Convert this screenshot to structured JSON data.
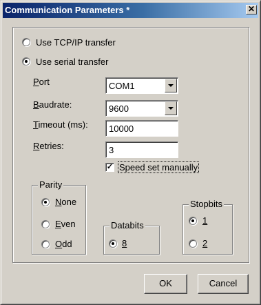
{
  "window": {
    "title": "Communication Parameters *",
    "close_glyph": "✕"
  },
  "transfer": {
    "tcpip_label": "Use TCP/IP transfer",
    "serial_label": "Use serial transfer",
    "selected": "serial"
  },
  "port": {
    "label_accel": "P",
    "label_rest": "ort",
    "value": "COM1"
  },
  "baudrate": {
    "label_accel": "B",
    "label_rest": "audrate:",
    "value": "9600"
  },
  "timeout": {
    "label_accel": "T",
    "label_rest": "imeout (ms):",
    "value": "10000"
  },
  "retries": {
    "label_accel": "R",
    "label_rest": "etries:",
    "value": "3"
  },
  "speed_manual": {
    "label": "Speed set manually",
    "checked": true,
    "check_glyph": "✓"
  },
  "parity": {
    "title": "Parity",
    "options": [
      {
        "accel": "N",
        "rest": "one",
        "selected": true
      },
      {
        "accel": "E",
        "rest": "ven",
        "selected": false
      },
      {
        "accel": "O",
        "rest": "dd",
        "selected": false
      }
    ]
  },
  "databits": {
    "title": "Databits",
    "options": [
      {
        "label": "8",
        "selected": true
      }
    ]
  },
  "stopbits": {
    "title": "Stopbits",
    "options": [
      {
        "label": "1",
        "selected": true
      },
      {
        "label": "2",
        "selected": false
      }
    ]
  },
  "buttons": {
    "ok": "OK",
    "cancel": "Cancel"
  },
  "icons": {
    "dropdown": "chevron-down-icon",
    "close": "close-icon",
    "check": "check-icon"
  },
  "colors": {
    "face": "#d4d0c8",
    "title_start": "#0a246a",
    "title_end": "#a6caf0"
  }
}
